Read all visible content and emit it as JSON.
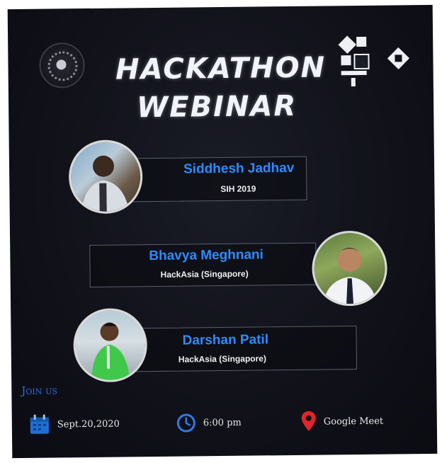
{
  "title": {
    "line1": "HACKATHON",
    "line2": "WEBINAR"
  },
  "speakers": [
    {
      "name": "Siddhesh Jadhav",
      "org": "SIH 2019"
    },
    {
      "name": "Bhavya Meghnani",
      "org": "HackAsia (Singapore)"
    },
    {
      "name": "Darshan Patil",
      "org": "HackAsia (Singapore)"
    }
  ],
  "join_label": "Join us",
  "event": {
    "date": "Sept.20,2020",
    "time": "6:00 pm",
    "location": "Google Meet"
  },
  "icons": {
    "date": "calendar-icon",
    "time": "clock-icon",
    "location": "map-pin-icon"
  },
  "colors": {
    "background": "#101119",
    "accent": "#2e8bff",
    "pin": "#e0262b"
  }
}
